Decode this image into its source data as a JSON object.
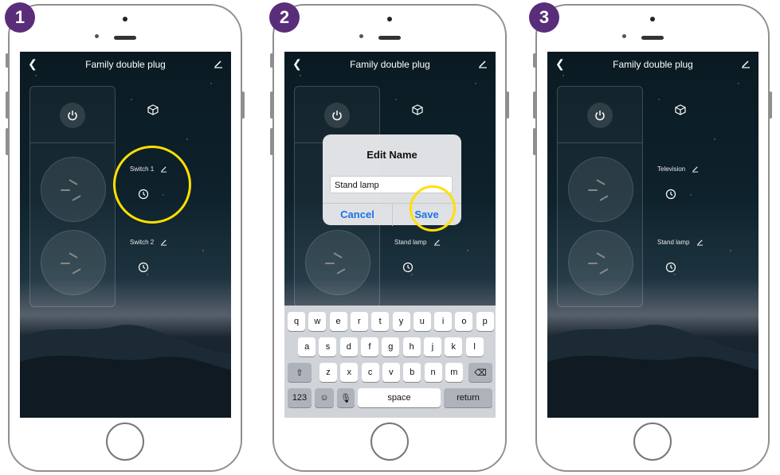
{
  "steps": [
    {
      "number": "1"
    },
    {
      "number": "2"
    },
    {
      "number": "3"
    }
  ],
  "app": {
    "title": "Family double plug",
    "back_icon": "chevron-left-icon",
    "edit_icon": "pencil-icon",
    "power_icon": "power-icon",
    "cube_icon": "cube-icon",
    "timer_icon": "clock-icon"
  },
  "screen1": {
    "switches": [
      {
        "label": "Switch 1"
      },
      {
        "label": "Switch 2"
      }
    ]
  },
  "screen2": {
    "dialog": {
      "title": "Edit Name",
      "input_value": "Stand lamp",
      "cancel_label": "Cancel",
      "save_label": "Save"
    },
    "switches": [
      {
        "label": "Stand lamp"
      }
    ],
    "keyboard": {
      "row1": [
        "q",
        "w",
        "e",
        "r",
        "t",
        "y",
        "u",
        "i",
        "o",
        "p"
      ],
      "row2": [
        "a",
        "s",
        "d",
        "f",
        "g",
        "h",
        "j",
        "k",
        "l"
      ],
      "row3": [
        "z",
        "x",
        "c",
        "v",
        "b",
        "n",
        "m"
      ],
      "numbers_label": "123",
      "space_label": "space",
      "return_label": "return"
    }
  },
  "screen3": {
    "switches": [
      {
        "label": "Television"
      },
      {
        "label": "Stand lamp"
      }
    ]
  },
  "colors": {
    "badge": "#5a2d7a",
    "highlight": "#ffe000",
    "dialog_button": "#1a73e8"
  }
}
